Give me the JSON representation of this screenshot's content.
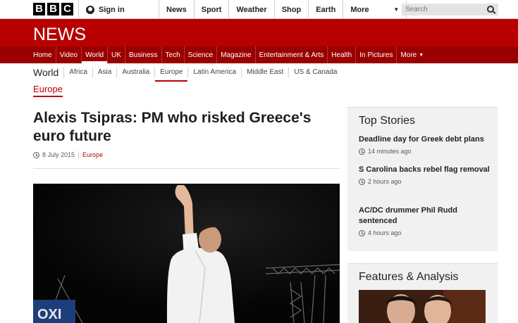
{
  "header": {
    "logo_letters": [
      "B",
      "B",
      "C"
    ],
    "signin_label": "Sign in",
    "nav": [
      "News",
      "Sport",
      "Weather",
      "Shop",
      "Earth"
    ],
    "more_label": "More",
    "search_placeholder": "Search"
  },
  "banner": {
    "title": "NEWS"
  },
  "news_nav": {
    "items": [
      "Home",
      "Video",
      "World",
      "UK",
      "Business",
      "Tech",
      "Science",
      "Magazine",
      "Entertainment & Arts",
      "Health",
      "In Pictures",
      "More"
    ],
    "active": "World"
  },
  "world_nav": {
    "title": "World",
    "items": [
      "Africa",
      "Asia",
      "Australia",
      "Europe",
      "Latin America",
      "Middle East",
      "US & Canada"
    ],
    "active": "Europe"
  },
  "section_label": "Europe",
  "article": {
    "headline": "Alexis Tsipras: PM who risked Greece's euro future",
    "date": "8 July 2015",
    "section": "Europe"
  },
  "top_stories": {
    "title": "Top Stories",
    "items": [
      {
        "title": "Deadline day for Greek debt plans",
        "time": "14 minutes ago"
      },
      {
        "title": "S Carolina backs rebel flag removal",
        "time": "2 hours ago"
      },
      {
        "title": "AC/DC drummer Phil Rudd sentenced",
        "time": "4 hours ago"
      }
    ]
  },
  "features": {
    "title": "Features & Analysis"
  },
  "colors": {
    "brand_red": "#b80000",
    "nav_red": "#9a0000"
  }
}
